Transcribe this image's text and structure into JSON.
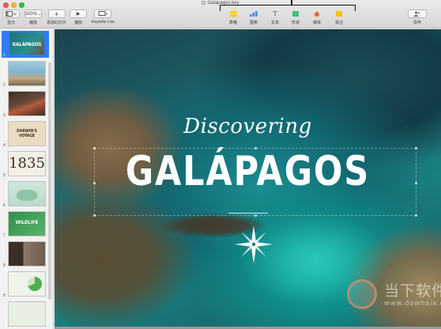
{
  "window": {
    "title": "Galapagos.key"
  },
  "toolbar": {
    "view_label": "显示",
    "zoom_value": "100%",
    "zoom_label": "缩放",
    "add_slide_label": "添加幻灯片",
    "play_label": "播放",
    "keynote_live_label": "Keynote Live",
    "table_label": "表格",
    "chart_label": "图表",
    "text_label": "文本",
    "shape_label": "形状",
    "media_label": "媒体",
    "comment_label": "批注",
    "collaborate_label": "协作",
    "text_glyph": "T",
    "plus_glyph": "+",
    "play_glyph": "▶"
  },
  "sidebar": {
    "slides": [
      {
        "num": "1",
        "title": "GALÁPAGOS",
        "selected": true
      },
      {
        "num": "2",
        "title": ""
      },
      {
        "num": "3",
        "title": ""
      },
      {
        "num": "4",
        "title": "DARWIN'S VOYAGE"
      },
      {
        "num": "5",
        "title": "1835"
      },
      {
        "num": "6",
        "title": ""
      },
      {
        "num": "7",
        "title": "WILDLIFE"
      },
      {
        "num": "8",
        "title": ""
      },
      {
        "num": "9",
        "title": ""
      }
    ]
  },
  "slide": {
    "subtitle": "Discovering",
    "title": "GALÁPAGOS"
  },
  "watermark": {
    "text": "当下软件园",
    "url": "www.downxia.com"
  },
  "colors": {
    "accent": "#2f7cf6",
    "table_icon": "#f5c400",
    "chart_icon": "#2b8ef0",
    "shape_icon": "#37c47a",
    "comment_icon": "#f5c400"
  }
}
